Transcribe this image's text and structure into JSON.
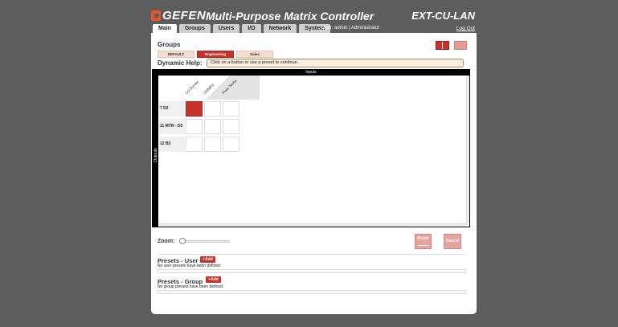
{
  "header": {
    "brand": "GEFEN",
    "app_title": "Multi-Purpose Matrix Controller",
    "model": "EXT-CU-LAN",
    "tabs": [
      "Main",
      "Groups",
      "Users",
      "I/O",
      "Network",
      "System"
    ],
    "active_tab": "Main",
    "user_info": "User: admin  |  Administrator",
    "logout": "Log Out"
  },
  "groups": {
    "title": "Groups",
    "items": [
      "DEFAULT",
      "Engineering",
      "Sales"
    ],
    "active": "Engineering"
  },
  "dynamic_help": {
    "label": "Dynamic Help:",
    "text": "Click on a button or use a preset to continue."
  },
  "matrix": {
    "inputs_label": "Inputs",
    "outputs_label": "Outputs",
    "inputs": [
      "LG Survey",
      "DSMPS",
      "Floor Techs"
    ],
    "outputs": [
      "7 D2",
      "11 MTR - D3",
      "12 B3"
    ],
    "routes": [
      [
        1,
        0,
        0
      ],
      [
        0,
        0,
        0
      ],
      [
        0,
        0,
        0
      ]
    ]
  },
  "controls": {
    "zoom_label": "Zoom:",
    "zoom_level": 0,
    "route_label": "Route",
    "cancel_label": "Cancel"
  },
  "presets_user": {
    "title": "Presets - User",
    "add_label": "+Add",
    "empty_msg": "No user presets have been defined."
  },
  "presets_group": {
    "title": "Presets - Group",
    "add_label": "+Add",
    "empty_msg": "No group presets have been defined."
  },
  "colors": {
    "accent": "#c8312a",
    "background": "#5d5d5d",
    "panel": "#ffffff"
  }
}
